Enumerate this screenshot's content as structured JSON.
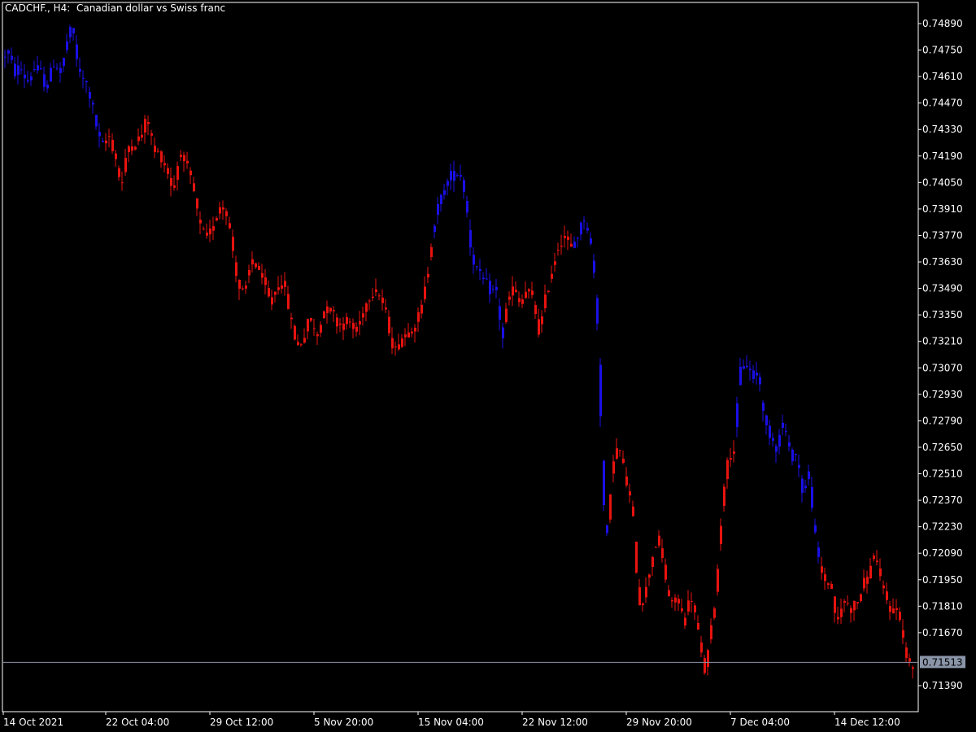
{
  "window": {
    "symbol": "CADCHF.",
    "timeframe": "H4",
    "description": "Canadian dollar vs Swiss franc",
    "title": "CADCHF., H4:  Canadian dollar vs Swiss franc"
  },
  "colors": {
    "background": "#000000",
    "frame": "#ffffff",
    "text": "#ffffff",
    "bull": "#1a10e6",
    "bear": "#e8130f",
    "price_line": "#8a95a8",
    "price_label_bg": "#8a95a8",
    "price_label_text": "#000000"
  },
  "chart_data": {
    "type": "bar",
    "indicator_note": "",
    "current_price": "0.71513",
    "ylim": [
      0.713,
      0.75
    ],
    "y_ticks": [
      "0.74890",
      "0.74750",
      "0.74610",
      "0.74470",
      "0.74330",
      "0.74190",
      "0.74050",
      "0.73910",
      "0.73770",
      "0.73630",
      "0.73490",
      "0.73350",
      "0.73210",
      "0.73070",
      "0.72930",
      "0.72790",
      "0.72650",
      "0.72510",
      "0.72370",
      "0.72230",
      "0.72090",
      "0.71950",
      "0.71810",
      "0.71670",
      "0.71390"
    ],
    "x_ticks": [
      "14 Oct 2021",
      "22 Oct 04:00",
      "29 Oct 12:00",
      "5 Nov 20:00",
      "15 Nov 04:00",
      "22 Nov 12:00",
      "29 Nov 20:00",
      "7 Dec 04:00",
      "14 Dec 12:00"
    ],
    "keypoints": [
      [
        0,
        0.7469,
        "blue"
      ],
      [
        8,
        0.7475,
        "blue"
      ],
      [
        16,
        0.7463,
        "blue"
      ],
      [
        24,
        0.7466,
        "blue"
      ],
      [
        32,
        0.7458,
        "blue"
      ],
      [
        40,
        0.7465,
        "blue"
      ],
      [
        48,
        0.7464,
        "blue"
      ],
      [
        56,
        0.7455,
        "blue"
      ],
      [
        66,
        0.747,
        "blue"
      ],
      [
        74,
        0.7462,
        "blue"
      ],
      [
        82,
        0.7482,
        "blue"
      ],
      [
        88,
        0.7486,
        "blue"
      ],
      [
        96,
        0.7462,
        "blue"
      ],
      [
        104,
        0.7458,
        "blue"
      ],
      [
        112,
        0.7447,
        "blue"
      ],
      [
        120,
        0.7428,
        "blue"
      ],
      [
        126,
        0.7423,
        "blue"
      ],
      [
        132,
        0.7431,
        "red"
      ],
      [
        140,
        0.742,
        "red"
      ],
      [
        148,
        0.7402,
        "red"
      ],
      [
        156,
        0.7424,
        "red"
      ],
      [
        164,
        0.7426,
        "red"
      ],
      [
        172,
        0.7429,
        "red"
      ],
      [
        180,
        0.744,
        "red"
      ],
      [
        188,
        0.7421,
        "red"
      ],
      [
        196,
        0.742,
        "red"
      ],
      [
        204,
        0.7412,
        "red"
      ],
      [
        212,
        0.74,
        "red"
      ],
      [
        220,
        0.7423,
        "red"
      ],
      [
        228,
        0.7413,
        "red"
      ],
      [
        236,
        0.7402,
        "red"
      ],
      [
        244,
        0.7382,
        "red"
      ],
      [
        252,
        0.7375,
        "red"
      ],
      [
        260,
        0.738,
        "red"
      ],
      [
        268,
        0.7393,
        "red"
      ],
      [
        276,
        0.7393,
        "red"
      ],
      [
        284,
        0.7372,
        "red"
      ],
      [
        292,
        0.735,
        "red"
      ],
      [
        300,
        0.7345,
        "red"
      ],
      [
        308,
        0.7365,
        "red"
      ],
      [
        316,
        0.736,
        "red"
      ],
      [
        324,
        0.735,
        "red"
      ],
      [
        332,
        0.734,
        "red"
      ],
      [
        340,
        0.7352,
        "red"
      ],
      [
        348,
        0.7352,
        "red"
      ],
      [
        356,
        0.7333,
        "red"
      ],
      [
        364,
        0.7318,
        "red"
      ],
      [
        372,
        0.7323,
        "red"
      ],
      [
        380,
        0.7334,
        "red"
      ],
      [
        388,
        0.7322,
        "red"
      ],
      [
        396,
        0.7337,
        "red"
      ],
      [
        404,
        0.734,
        "red"
      ],
      [
        412,
        0.7332,
        "red"
      ],
      [
        420,
        0.733,
        "red"
      ],
      [
        428,
        0.7332,
        "red"
      ],
      [
        436,
        0.7325,
        "red"
      ],
      [
        444,
        0.7335,
        "red"
      ],
      [
        452,
        0.7345,
        "red"
      ],
      [
        460,
        0.735,
        "red"
      ],
      [
        468,
        0.7343,
        "red"
      ],
      [
        476,
        0.733,
        "red"
      ],
      [
        484,
        0.7315,
        "red"
      ],
      [
        492,
        0.7323,
        "red"
      ],
      [
        500,
        0.7326,
        "red"
      ],
      [
        508,
        0.733,
        "red"
      ],
      [
        516,
        0.7336,
        "red"
      ],
      [
        524,
        0.7355,
        "red"
      ],
      [
        530,
        0.7378,
        "red"
      ],
      [
        536,
        0.739,
        "blue"
      ],
      [
        544,
        0.74,
        "blue"
      ],
      [
        552,
        0.7408,
        "blue"
      ],
      [
        560,
        0.741,
        "blue"
      ],
      [
        566,
        0.741,
        "blue"
      ],
      [
        572,
        0.7394,
        "blue"
      ],
      [
        578,
        0.7368,
        "blue"
      ],
      [
        586,
        0.7358,
        "blue"
      ],
      [
        594,
        0.7352,
        "blue"
      ],
      [
        602,
        0.7348,
        "blue"
      ],
      [
        610,
        0.7347,
        "blue"
      ],
      [
        616,
        0.732,
        "blue"
      ],
      [
        622,
        0.734,
        "red"
      ],
      [
        630,
        0.735,
        "red"
      ],
      [
        638,
        0.734,
        "red"
      ],
      [
        646,
        0.7348,
        "red"
      ],
      [
        654,
        0.7343,
        "red"
      ],
      [
        662,
        0.7325,
        "red"
      ],
      [
        670,
        0.7345,
        "red"
      ],
      [
        678,
        0.736,
        "red"
      ],
      [
        686,
        0.7373,
        "red"
      ],
      [
        694,
        0.7378,
        "red"
      ],
      [
        700,
        0.7368,
        "red"
      ],
      [
        706,
        0.7375,
        "blue"
      ],
      [
        712,
        0.738,
        "blue"
      ],
      [
        718,
        0.7388,
        "blue"
      ],
      [
        724,
        0.7375,
        "blue"
      ],
      [
        730,
        0.7353,
        "blue"
      ],
      [
        734,
        0.7325,
        "blue"
      ],
      [
        738,
        0.727,
        "blue"
      ],
      [
        742,
        0.7222,
        "blue"
      ],
      [
        746,
        0.7215,
        "blue"
      ],
      [
        752,
        0.726,
        "red"
      ],
      [
        760,
        0.7265,
        "red"
      ],
      [
        768,
        0.7248,
        "red"
      ],
      [
        776,
        0.7232,
        "red"
      ],
      [
        784,
        0.7183,
        "red"
      ],
      [
        792,
        0.7187,
        "red"
      ],
      [
        800,
        0.7207,
        "red"
      ],
      [
        808,
        0.7218,
        "red"
      ],
      [
        816,
        0.7198,
        "red"
      ],
      [
        824,
        0.718,
        "red"
      ],
      [
        832,
        0.7186,
        "red"
      ],
      [
        840,
        0.7172,
        "red"
      ],
      [
        848,
        0.7188,
        "red"
      ],
      [
        856,
        0.717,
        "red"
      ],
      [
        864,
        0.7145,
        "red"
      ],
      [
        870,
        0.7158,
        "red"
      ],
      [
        876,
        0.7178,
        "red"
      ],
      [
        882,
        0.7205,
        "red"
      ],
      [
        888,
        0.7245,
        "red"
      ],
      [
        896,
        0.7262,
        "red"
      ],
      [
        902,
        0.7265,
        "red"
      ],
      [
        908,
        0.7305,
        "blue"
      ],
      [
        916,
        0.731,
        "blue"
      ],
      [
        924,
        0.7302,
        "blue"
      ],
      [
        932,
        0.7305,
        "blue"
      ],
      [
        938,
        0.7278,
        "blue"
      ],
      [
        946,
        0.7272,
        "blue"
      ],
      [
        954,
        0.7265,
        "blue"
      ],
      [
        962,
        0.728,
        "blue"
      ],
      [
        970,
        0.726,
        "blue"
      ],
      [
        978,
        0.7262,
        "blue"
      ],
      [
        986,
        0.724,
        "blue"
      ],
      [
        994,
        0.7252,
        "blue"
      ],
      [
        1000,
        0.722,
        "blue"
      ],
      [
        1006,
        0.7202,
        "blue"
      ],
      [
        1012,
        0.7195,
        "red"
      ],
      [
        1020,
        0.7193,
        "red"
      ],
      [
        1028,
        0.717,
        "red"
      ],
      [
        1036,
        0.7185,
        "red"
      ],
      [
        1044,
        0.718,
        "red"
      ],
      [
        1052,
        0.7182,
        "red"
      ],
      [
        1060,
        0.7192,
        "red"
      ],
      [
        1068,
        0.7198,
        "red"
      ],
      [
        1074,
        0.7212,
        "red"
      ],
      [
        1080,
        0.7195,
        "red"
      ],
      [
        1088,
        0.7185,
        "red"
      ],
      [
        1096,
        0.7178,
        "red"
      ],
      [
        1104,
        0.718,
        "red"
      ],
      [
        1110,
        0.716,
        "red"
      ],
      [
        1116,
        0.715,
        "red"
      ],
      [
        1122,
        0.7148,
        "red"
      ]
    ]
  }
}
